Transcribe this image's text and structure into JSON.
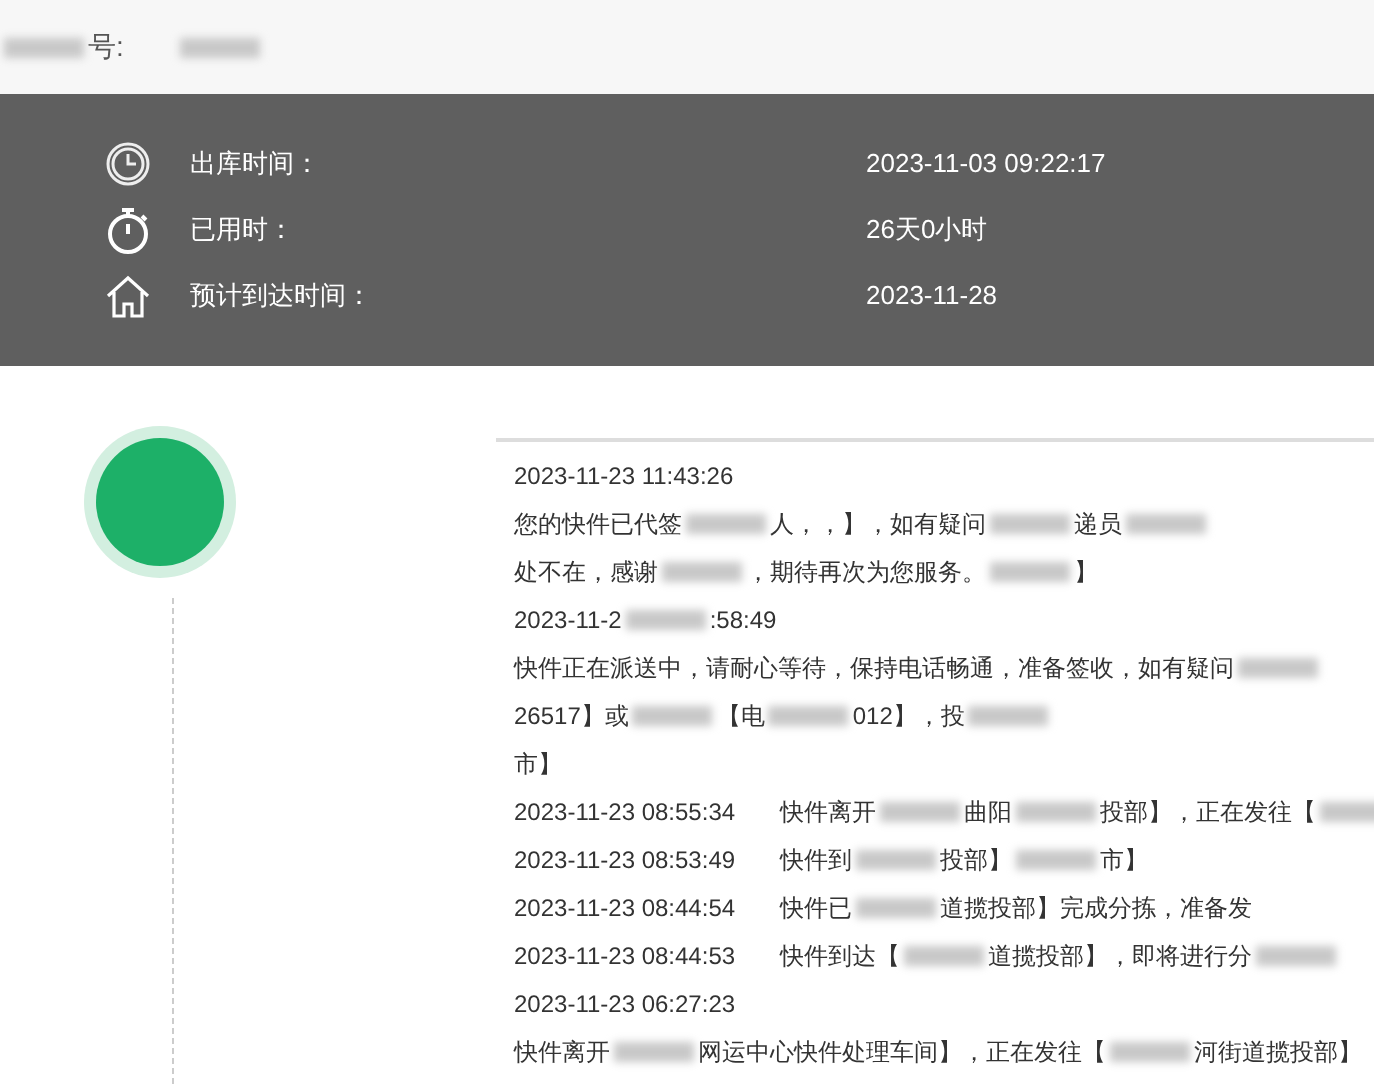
{
  "header": {
    "label": [
      {
        "kind": "redacted"
      },
      {
        "kind": "text",
        "text": "号:"
      }
    ],
    "tracking_number": [
      {
        "kind": "redacted"
      }
    ]
  },
  "summary": [
    {
      "kind": "clock",
      "label": "出库时间：",
      "value": "2023-11-03 09:22:17"
    },
    {
      "kind": "stopwatch",
      "label": "已用时：",
      "value": "26天0小时"
    },
    {
      "kind": "home",
      "label": "预计到达时间：",
      "value": "2023-11-28"
    }
  ],
  "timeline": [
    {
      "kind": "time",
      "segments": [
        {
          "kind": "text",
          "text": "2023-11-23 11:43:26"
        }
      ]
    },
    {
      "kind": "message",
      "segments": [
        {
          "kind": "text",
          "text": "您的快件已代签"
        },
        {
          "kind": "redacted"
        },
        {
          "kind": "text",
          "text": "人，，】，如有疑问"
        },
        {
          "kind": "redacted"
        },
        {
          "kind": "text",
          "text": "递员"
        },
        {
          "kind": "redacted"
        }
      ]
    },
    {
      "kind": "message",
      "segments": [
        {
          "kind": "text",
          "text": "处不在，感谢"
        },
        {
          "kind": "redacted"
        },
        {
          "kind": "text",
          "text": "，期待再次为您服务。"
        },
        {
          "kind": "redacted"
        },
        {
          "kind": "text",
          "text": "】"
        }
      ]
    },
    {
      "kind": "time",
      "segments": [
        {
          "kind": "text",
          "text": "2023-11-2"
        },
        {
          "kind": "redacted"
        },
        {
          "kind": "text",
          "text": ":58:49"
        }
      ]
    },
    {
      "kind": "message",
      "segments": [
        {
          "kind": "text",
          "text": "快件正在派送中，请耐心等待，保持电话畅通，准备签收，如有疑问"
        },
        {
          "kind": "redacted"
        }
      ]
    },
    {
      "kind": "message",
      "segments": [
        {
          "kind": "text",
          "text": "26517】或"
        },
        {
          "kind": "redacted"
        },
        {
          "kind": "text",
          "text": "【电"
        },
        {
          "kind": "redacted"
        },
        {
          "kind": "text",
          "text": "012】，投"
        },
        {
          "kind": "redacted"
        }
      ]
    },
    {
      "kind": "message",
      "segments": [
        {
          "kind": "text",
          "text": "市】"
        }
      ]
    },
    {
      "kind": "inline",
      "time": "2023-11-23 08:55:34",
      "segments": [
        {
          "kind": "text",
          "text": "快件离开"
        },
        {
          "kind": "redacted"
        },
        {
          "kind": "text",
          "text": "曲阳"
        },
        {
          "kind": "redacted"
        },
        {
          "kind": "text",
          "text": "投部】，正在发往【"
        },
        {
          "kind": "redacted"
        }
      ]
    },
    {
      "kind": "inline",
      "time": "2023-11-23 08:53:49",
      "segments": [
        {
          "kind": "text",
          "text": "快件到"
        },
        {
          "kind": "redacted"
        },
        {
          "kind": "text",
          "text": "投部】"
        },
        {
          "kind": "redacted"
        },
        {
          "kind": "text",
          "text": "市】"
        }
      ]
    },
    {
      "kind": "inline",
      "time": "2023-11-23 08:44:54",
      "segments": [
        {
          "kind": "text",
          "text": "快件已"
        },
        {
          "kind": "redacted"
        },
        {
          "kind": "text",
          "text": "道揽投部】完成分拣，准备发"
        }
      ]
    },
    {
      "kind": "inline",
      "time": "2023-11-23 08:44:53",
      "segments": [
        {
          "kind": "text",
          "text": "快件到达【"
        },
        {
          "kind": "redacted"
        },
        {
          "kind": "text",
          "text": "道揽投部】，即将进行分"
        },
        {
          "kind": "redacted"
        }
      ]
    },
    {
      "kind": "time",
      "segments": [
        {
          "kind": "text",
          "text": "2023-11-23 06:27:23"
        }
      ]
    },
    {
      "kind": "message",
      "segments": [
        {
          "kind": "text",
          "text": "快件离开"
        },
        {
          "kind": "redacted"
        },
        {
          "kind": "text",
          "text": "网运中心快件处理车间】，正在发往【"
        },
        {
          "kind": "redacted"
        },
        {
          "kind": "text",
          "text": "河街道揽投部】"
        }
      ]
    }
  ]
}
